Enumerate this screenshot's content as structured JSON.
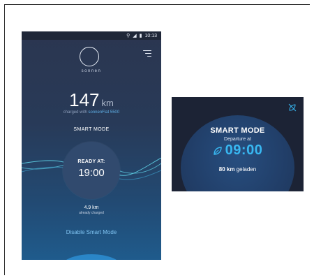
{
  "statusbar": {
    "time": "10:13",
    "location_icon": "location-pin-icon",
    "signal_icon": "signal-4g-icon",
    "battery_icon": "battery-icon"
  },
  "app": {
    "brand": "sonnen"
  },
  "range": {
    "value": "147",
    "unit": "km",
    "charged_prefix": "charged with",
    "charged_product": "sonnenFlat 5500"
  },
  "mode": {
    "label": "SMART MODE"
  },
  "ready": {
    "label": "READY AT:",
    "time": "19:00"
  },
  "charged_amount": {
    "value": "4.9 km",
    "caption": "already charged"
  },
  "actions": {
    "disable_label": "Disable Smart Mode"
  },
  "widget": {
    "title": "SMART MODE",
    "departure_label": "Departure at",
    "departure_time": "09:00",
    "charged_value": "80 km",
    "charged_suffix": "geladen"
  },
  "colors": {
    "accent": "#38b8f2",
    "link": "#7fc4f2",
    "card_bg": "#1c2335"
  }
}
